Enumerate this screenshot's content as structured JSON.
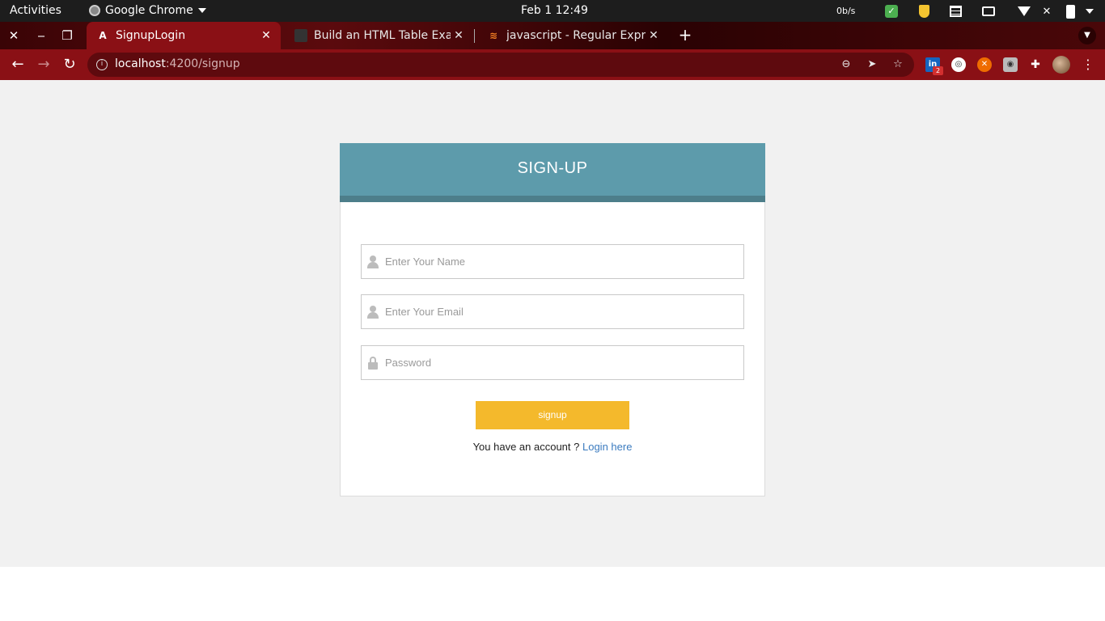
{
  "system_bar": {
    "activities": "Activities",
    "app_name": "Google Chrome",
    "clock": "Feb 1  12:49",
    "netspeed": "0b/s"
  },
  "browser": {
    "tabs": [
      {
        "title": "SignupLogin",
        "favicon": "A",
        "active": true
      },
      {
        "title": "Build an HTML Table Exan",
        "favicon": "",
        "active": false
      },
      {
        "title": "javascript - Regular Expre",
        "favicon": "≋",
        "active": false
      }
    ],
    "url_host": "localhost",
    "url_rest": ":4200/signup",
    "extension_badge": "2",
    "theme_color": "#8a1015"
  },
  "page": {
    "header_title": "SIGN-UP",
    "name_placeholder": "Enter Your Name",
    "email_placeholder": "Enter Your Email",
    "password_placeholder": "Password",
    "signup_label": "signup",
    "account_prompt": "You have an account ?",
    "login_link": "Login here",
    "colors": {
      "header": "#5d9bab",
      "header_border": "#4d7e8a",
      "button": "#f4b92c",
      "link": "#3b7bbf",
      "background": "#f1f1f1"
    }
  }
}
